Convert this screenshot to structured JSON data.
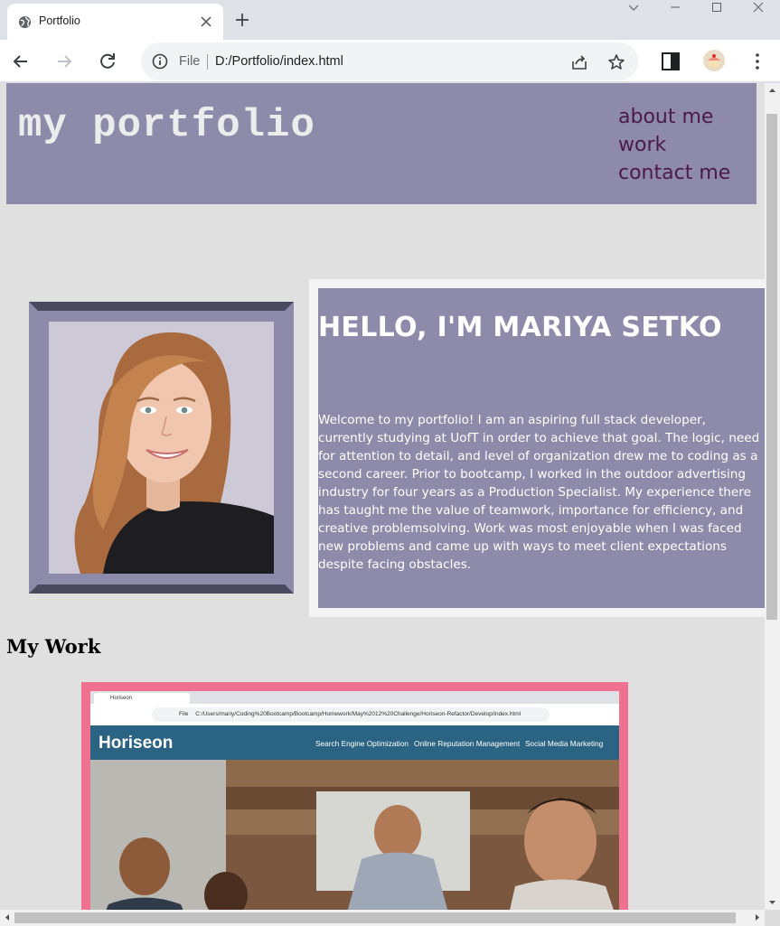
{
  "browser": {
    "tab_title": "Portfolio",
    "omnibox_scheme": "File",
    "url": "D:/Portfolio/index.html"
  },
  "site": {
    "title": "my portfolio",
    "nav": [
      "about me",
      "work",
      "contact me"
    ],
    "colors": {
      "panel": "#8e8aa9",
      "nav_link": "#4a1a4c",
      "work_card_border": "#f07090"
    }
  },
  "about": {
    "heading": "HELLO, I'M MARIYA SETKO",
    "text": "Welcome to my portfolio! I am an aspiring full stack developer, currently studying at UofT in order to achieve that goal. The logic, need for attention to detail, and level of organization drew me to coding as a second career. Prior to bootcamp, I worked in the outdoor advertising industry for four years as a Production Specialist. My experience there has taught me the value of teamwork, importance for efficiency, and creative problemsolving. Work was most enjoyable when I was faced new problems and came up with ways to meet client expectations despite facing obstacles."
  },
  "work": {
    "heading": "My Work",
    "screenshot": {
      "tab_title": "Horiseon",
      "url_scheme": "File",
      "url": "C:/Users/mariy/Coding%20Bootcamp/Bootcamp/Homework/May%2012%20Challenge/Horiseon-Refactor/Develop/index.html",
      "logo": "Horiseon",
      "nav": [
        "Search Engine Optimization",
        "Online Reputation Management",
        "Social Media Marketing"
      ]
    }
  }
}
